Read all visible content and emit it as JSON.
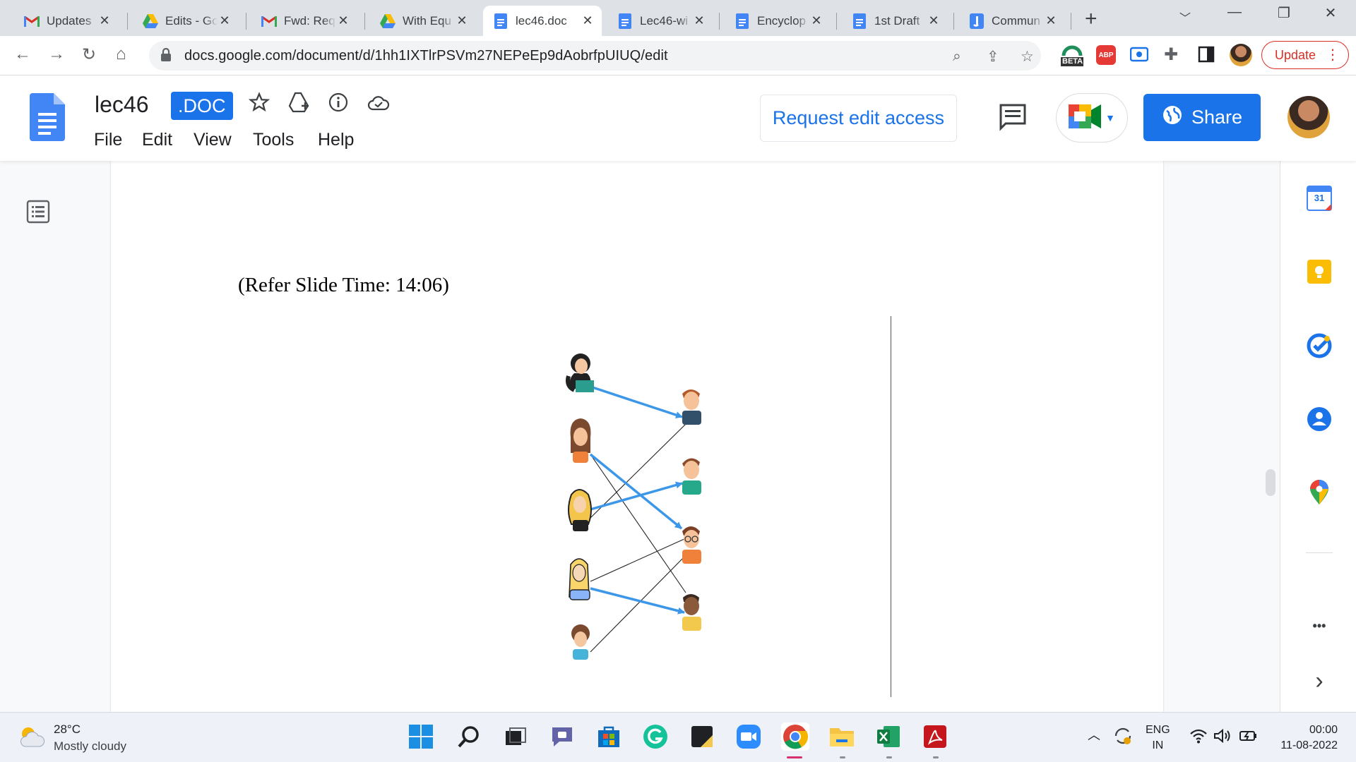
{
  "browser": {
    "tabs": [
      {
        "title": "Updates",
        "icon": "gmail-icon"
      },
      {
        "title": "Edits - Go",
        "icon": "drive-icon"
      },
      {
        "title": "Fwd: Req",
        "icon": "gmail-icon"
      },
      {
        "title": "With Equ",
        "icon": "drive-icon"
      },
      {
        "title": "lec46.doc",
        "icon": "docs-icon",
        "active": true
      },
      {
        "title": "Lec46-wi",
        "icon": "docs-icon"
      },
      {
        "title": "Encyclop",
        "icon": "docs-icon"
      },
      {
        "title": "1st Draft",
        "icon": "docs-icon"
      },
      {
        "title": "Commun",
        "icon": "jamboard-icon"
      }
    ],
    "url": "docs.google.com/document/d/1hh1IXTlrPSVm27NEPeEp9dAobrfpUIUQ/edit",
    "update_label": "Update",
    "extension_badge": "BETA",
    "abp_label": "ABP"
  },
  "docs": {
    "title": "lec46",
    "badge": ".DOC",
    "menu": [
      "File",
      "Edit",
      "View",
      "Tools",
      "Help"
    ],
    "request_edit_label": "Request edit access",
    "share_label": "Share"
  },
  "document": {
    "slide_ref": "(Refer Slide Time: 14:06)"
  },
  "sidepanel": {
    "calendar_day": "31",
    "more_label": "•••",
    "expand_label": "›"
  },
  "taskbar": {
    "weather_temp": "28°C",
    "weather_desc": "Mostly cloudy",
    "lang_line1": "ENG",
    "lang_line2": "IN",
    "time": "00:00",
    "date": "11-08-2022"
  },
  "colors": {
    "accent": "#1a73e8",
    "update_red": "#d93025",
    "arrow_blue": "#3d97e8"
  }
}
